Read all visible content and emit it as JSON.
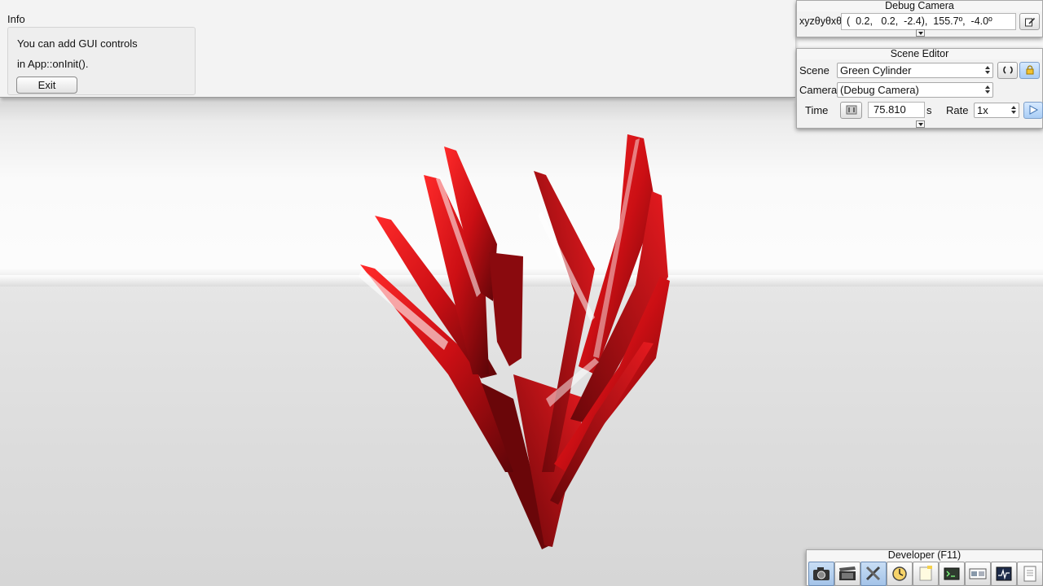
{
  "info": {
    "title": "Info",
    "line1": "You can add GUI controls",
    "line2": "in App::onInit().",
    "exit_label": "Exit"
  },
  "debug_camera": {
    "title": "Debug Camera",
    "label": "xyzθyθxθz",
    "value": "(  0.2,   0.2,  -2.4),  155.7º,  -4.0º",
    "copy_icon": "clipboard-pencil-icon"
  },
  "scene_editor": {
    "title": "Scene Editor",
    "scene_label": "Scene",
    "scene_value": "Green Cylinder",
    "reload_icon": "reload-icon",
    "lock_icon": "lock-icon",
    "camera_label": "Camera",
    "camera_value": "(Debug Camera)",
    "time_label": "Time",
    "time_value": "75.810",
    "time_unit": "s",
    "rate_label": "Rate",
    "rate_value": "1x",
    "play_icon": "play-icon"
  },
  "developer": {
    "title": "Developer (F11)",
    "icons": [
      "camera-icon",
      "film-clapper-icon",
      "tools-icon",
      "profiler-clock-icon",
      "notepad-icon",
      "console-icon",
      "scene-graph-icon",
      "graphics-stats-icon",
      "document-icon"
    ]
  },
  "colors": {
    "object_red": "#d9121a",
    "object_dark": "#5c0508",
    "panel_bg": "#f2f2f2",
    "active_blue": "#a9cdf5"
  }
}
